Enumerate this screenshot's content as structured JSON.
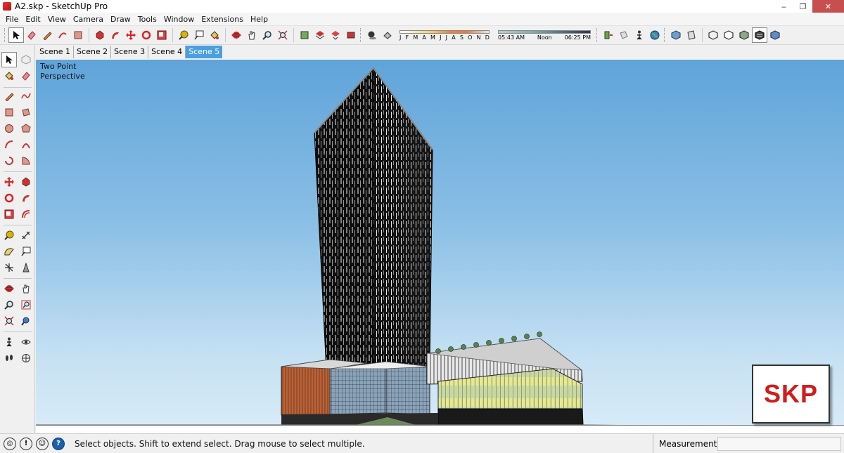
{
  "window": {
    "title": "A2.skp - SketchUp Pro",
    "controls": [
      "‒",
      "❐",
      "✕"
    ]
  },
  "menu": [
    "File",
    "Edit",
    "View",
    "Camera",
    "Draw",
    "Tools",
    "Window",
    "Extensions",
    "Help"
  ],
  "shadow": {
    "months": [
      "J",
      "F",
      "M",
      "A",
      "M",
      "J",
      "J",
      "A",
      "S",
      "O",
      "N",
      "D"
    ],
    "time_start": "05:43 AM",
    "time_mid": "Noon",
    "time_end": "06:25 PM"
  },
  "scenes": [
    "Scene 1",
    "Scene 2",
    "Scene 3",
    "Scene 4",
    "Scene 5"
  ],
  "active_scene": "Scene 5",
  "viewport": {
    "camera_line1": "Two Point",
    "camera_line2": "Perspective"
  },
  "watermark": "SKP",
  "status": {
    "text": "Select objects. Shift to extend select. Drag mouse to select multiple.",
    "measurements_label": "Measurements",
    "measurements_value": ""
  },
  "colors": {
    "accent": "#4a9fe0",
    "sky_top": "#5fa4d9",
    "sky_bottom": "#d9ecf8",
    "skp_red": "#d01c1c"
  }
}
